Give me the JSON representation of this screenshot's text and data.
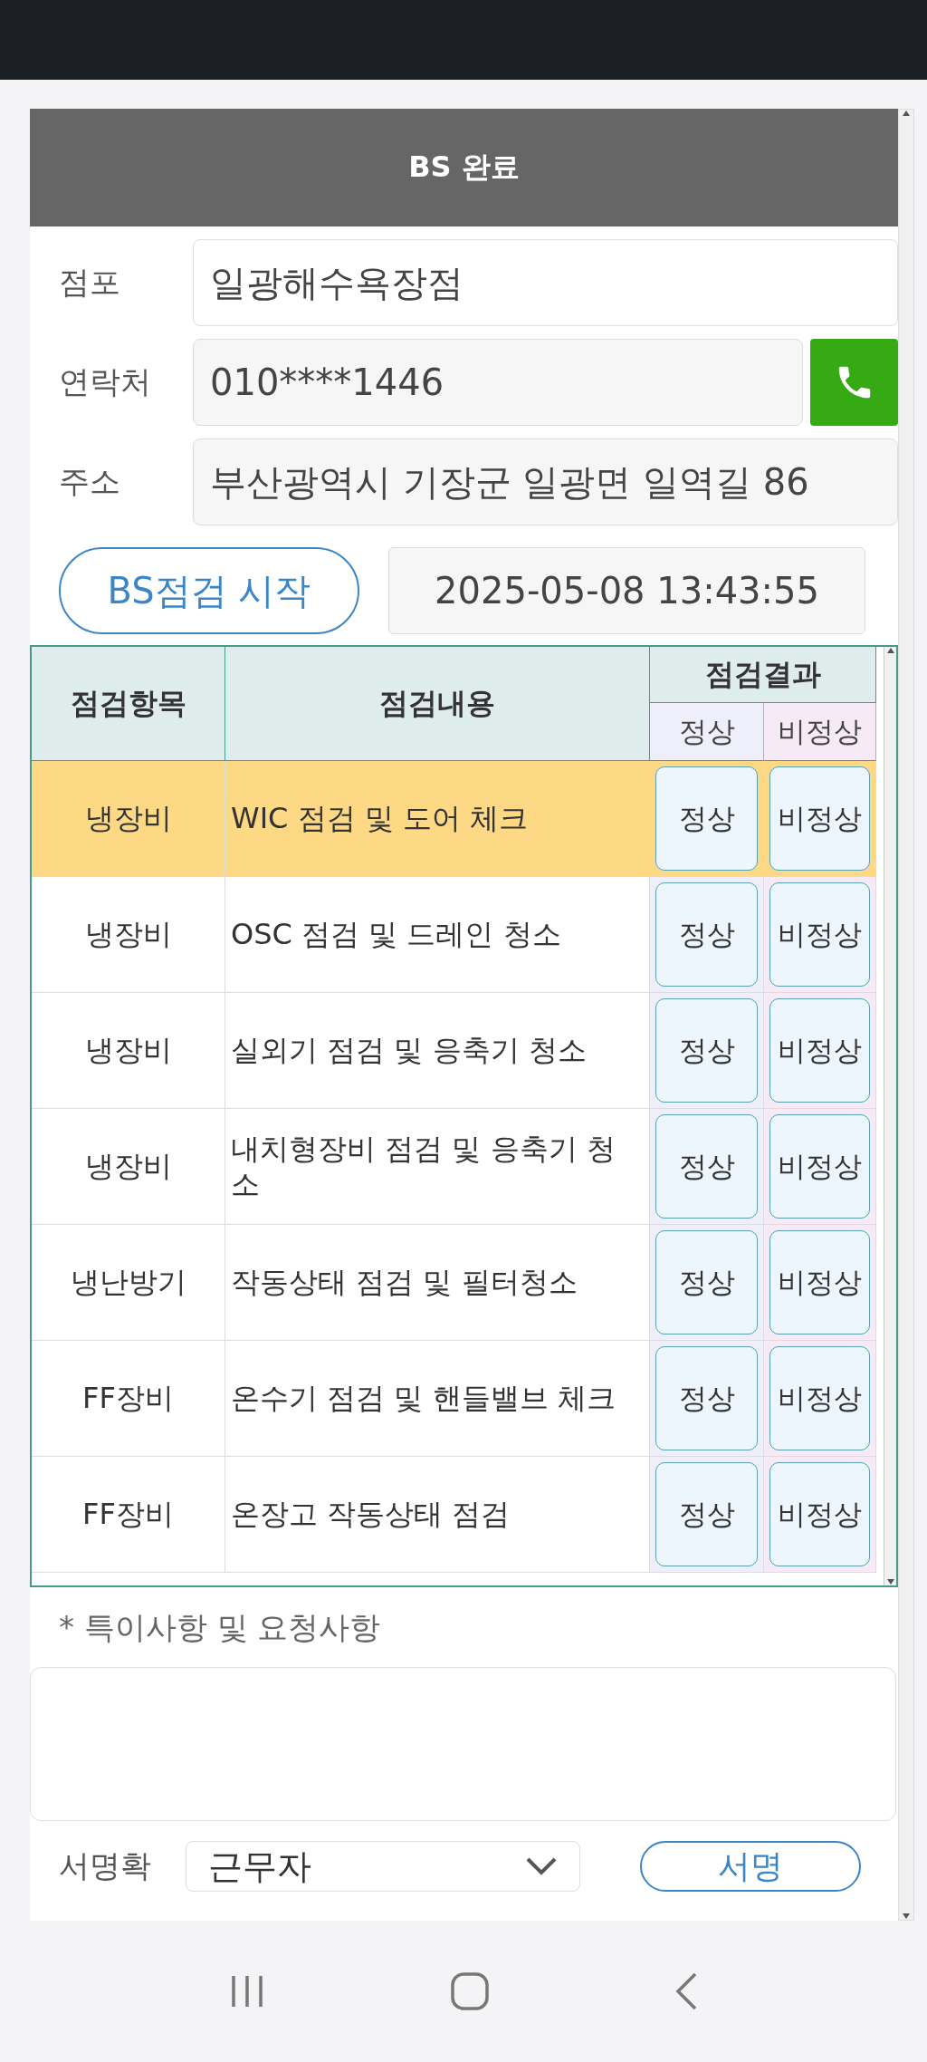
{
  "title": "BS 완료",
  "fields": [
    {
      "label": "점포",
      "value": "일광해수욕장점",
      "kind": "text"
    },
    {
      "label": "연락처",
      "value": "010****1446",
      "kind": "phone"
    },
    {
      "label": "주소",
      "value": "부산광역시 기장군 일광면 일역길 86",
      "kind": "text"
    }
  ],
  "start_button": "BS점검 시작",
  "start_time": "2025-05-08 13:43:55",
  "table": {
    "columns": [
      "점검항목",
      "점검내용",
      "점검결과"
    ],
    "result_columns": [
      "정상",
      "비정상"
    ],
    "rows": [
      {
        "item": "냉장비",
        "content": "WIC 점검 및 도어 체크",
        "selected": true,
        "buttons": [
          "정상",
          "비정상"
        ]
      },
      {
        "item": "냉장비",
        "content": "OSC 점검 및 드레인 청소",
        "selected": false,
        "buttons": [
          "정상",
          "비정상"
        ]
      },
      {
        "item": "냉장비",
        "content": "실외기 점검 및 응축기 청소",
        "selected": false,
        "buttons": [
          "정상",
          "비정상"
        ]
      },
      {
        "item": "냉장비",
        "content": "내치형장비 점검 및 응축기 청소",
        "selected": false,
        "buttons": [
          "정상",
          "비정상"
        ]
      },
      {
        "item": "냉난방기",
        "content": "작동상태 점검 및 필터청소",
        "selected": false,
        "buttons": [
          "정상",
          "비정상"
        ]
      },
      {
        "item": "FF장비",
        "content": "온수기 점검 및 핸들밸브 체크",
        "selected": false,
        "buttons": [
          "정상",
          "비정상"
        ]
      },
      {
        "item": "FF장비",
        "content": "온장고 작동상태 점검",
        "selected": false,
        "buttons": [
          "정상",
          "비정상"
        ]
      }
    ]
  },
  "note_label": "* 특이사항 및 요청사항",
  "signature": {
    "label": "서명확",
    "value": "근무자",
    "button": "서명"
  }
}
